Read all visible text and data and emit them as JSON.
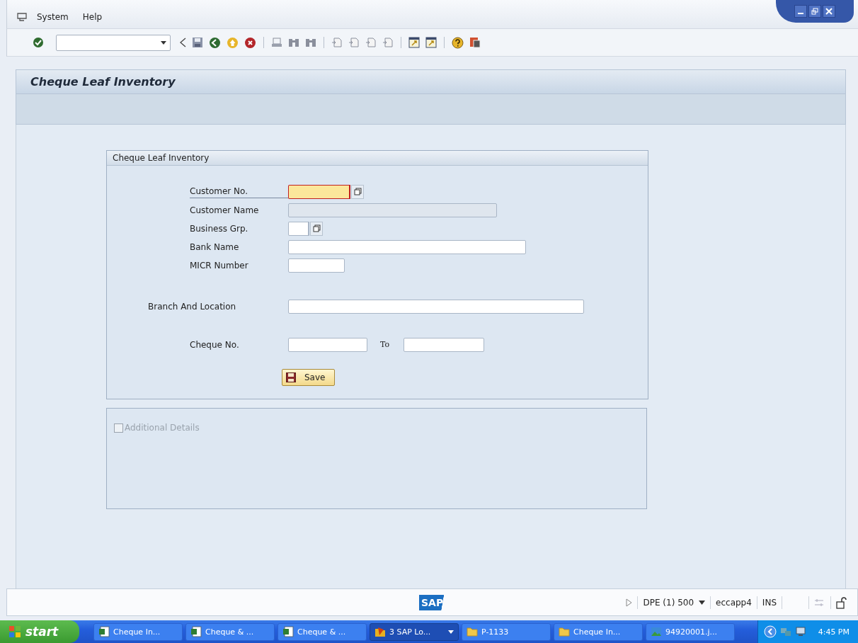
{
  "menu": [
    {
      "label": "System"
    },
    {
      "label": "Help"
    }
  ],
  "screen_title": "Cheque Leaf Inventory",
  "group": {
    "title": "Cheque Leaf Inventory",
    "fields": [
      {
        "label": "Customer No.",
        "focused": true,
        "disabled": false,
        "search_help": true
      },
      {
        "label": "Customer Name",
        "focused": false,
        "disabled": true,
        "search_help": false
      },
      {
        "label": "Business Grp.",
        "focused": false,
        "disabled": false,
        "search_help": true
      },
      {
        "label": "Bank Name",
        "focused": false,
        "disabled": false,
        "search_help": false
      },
      {
        "label": "MICR Number",
        "focused": false,
        "disabled": false,
        "search_help": false
      },
      {
        "label": "Branch And Location",
        "focused": false,
        "disabled": false,
        "search_help": false
      },
      {
        "label": "Cheque No.",
        "focused": false,
        "disabled": false,
        "search_help": false,
        "range_label": "To"
      }
    ],
    "save_button": "Save"
  },
  "additional": {
    "label": "Additional Details",
    "checked": false,
    "disabled": true
  },
  "status_bar": {
    "logo": "SAP",
    "system": "DPE (1) 500",
    "server": "eccapp4",
    "mode": "INS"
  },
  "taskbar": {
    "start": "start",
    "tasks": [
      {
        "label": "Cheque In...",
        "kind": "excel",
        "selected": false
      },
      {
        "label": "Cheque & ...",
        "kind": "excel",
        "selected": false
      },
      {
        "label": "Cheque & ...",
        "kind": "excel",
        "selected": false
      },
      {
        "label": "3 SAP Lo...",
        "kind": "sap",
        "selected": true
      },
      {
        "label": "P-1133",
        "kind": "folder",
        "selected": false
      },
      {
        "label": "Cheque In...",
        "kind": "folder",
        "selected": false
      },
      {
        "label": "94920001.j...",
        "kind": "image",
        "selected": false
      }
    ],
    "time": "4:45 PM"
  }
}
